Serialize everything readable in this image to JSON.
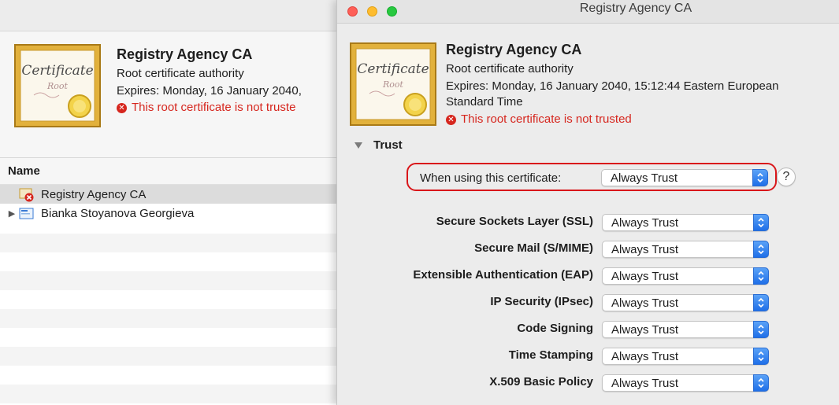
{
  "left_window": {
    "cert": {
      "icon_word": "Certificate",
      "icon_sub": "Root",
      "name": "Registry Agency CA",
      "kind": "Root certificate authority",
      "expires": "Expires: Monday, 16 January 2040,",
      "warning": "This root certificate is not truste"
    },
    "list": {
      "header": "Name",
      "rows": [
        {
          "label": "Registry Agency CA",
          "icon": "certificate-untrusted-icon"
        },
        {
          "label": "Bianka Stoyanova Georgieva",
          "icon": "certificate-icon",
          "disclosure": "collapsed"
        }
      ]
    }
  },
  "dialog": {
    "title": "Registry Agency CA",
    "cert": {
      "icon_word": "Certificate",
      "icon_sub": "Root",
      "name": "Registry Agency CA",
      "kind": "Root certificate authority",
      "expires_line1": "Expires: Monday, 16 January 2040, 15:12:44 Eastern European",
      "expires_line2": "Standard Time",
      "warning": "This root certificate is not trusted"
    },
    "trust": {
      "section_label": "Trust",
      "when_using_label": "When using this certificate:",
      "when_using_value": "Always Trust",
      "help_label": "?",
      "policies": [
        {
          "label": "Secure Sockets Layer (SSL)",
          "value": "Always Trust"
        },
        {
          "label": "Secure Mail (S/MIME)",
          "value": "Always Trust"
        },
        {
          "label": "Extensible Authentication (EAP)",
          "value": "Always Trust"
        },
        {
          "label": "IP Security (IPsec)",
          "value": "Always Trust"
        },
        {
          "label": "Code Signing",
          "value": "Always Trust"
        },
        {
          "label": "Time Stamping",
          "value": "Always Trust"
        },
        {
          "label": "X.509 Basic Policy",
          "value": "Always Trust"
        }
      ]
    }
  },
  "colors": {
    "warning_red": "#d6261e",
    "highlight_red": "#d9161a",
    "popup_blue": "#1f6fe8"
  }
}
